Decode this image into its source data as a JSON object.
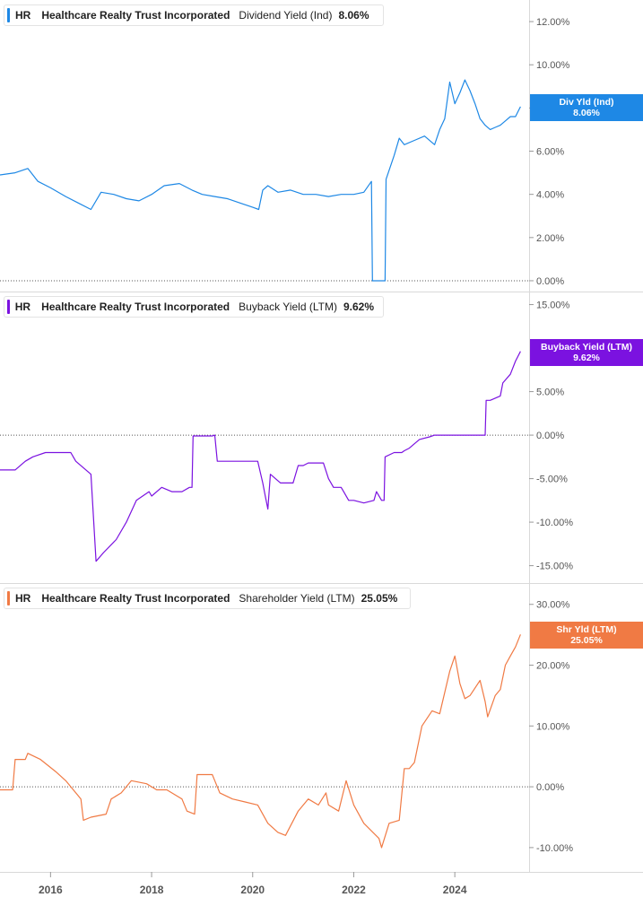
{
  "colors": {
    "dividend": "#1e88e5",
    "buyback": "#7b12e0",
    "shareholder": "#f07a44",
    "grid": "#d9d9d9",
    "axis_text": "#555555"
  },
  "x_axis": {
    "tick_labels": [
      "2016",
      "2018",
      "2020",
      "2022",
      "2024"
    ]
  },
  "chart_data": [
    {
      "type": "line",
      "ticker": "HR",
      "company": "Healthcare Realty Trust Incorporated",
      "metric": "Dividend Yield (Ind)",
      "current_value": "8.06%",
      "badge_label": "Div Yld (Ind)",
      "badge_value": "8.06%",
      "y_unit": "%",
      "ylim": [
        -0.5,
        13.0
      ],
      "yticks": [
        0,
        2,
        4,
        6,
        8,
        10,
        12
      ],
      "ytick_labels": [
        "0.00%",
        "2.00%",
        "4.00%",
        "6.00%",
        "8.00%",
        "10.00%",
        "12.00%"
      ],
      "zero_line": "dotted",
      "series": [
        {
          "x": [
            2015.0,
            2015.3,
            2015.55,
            2015.75,
            2016.0,
            2016.3,
            2016.55,
            2016.8,
            2017.0,
            2017.25,
            2017.5,
            2017.75,
            2018.0,
            2018.25,
            2018.55,
            2018.8,
            2019.0,
            2019.25,
            2019.5,
            2019.75,
            2020.0,
            2020.12,
            2020.2,
            2020.3,
            2020.5,
            2020.75,
            2021.0,
            2021.25,
            2021.5,
            2021.75,
            2022.0,
            2022.2,
            2022.35,
            2022.37,
            2022.62,
            2022.64,
            2022.8,
            2022.9,
            2023.0,
            2023.2,
            2023.4,
            2023.6,
            2023.7,
            2023.8,
            2023.9,
            2024.0,
            2024.1,
            2024.2,
            2024.3,
            2024.4,
            2024.5,
            2024.6,
            2024.7,
            2024.8,
            2024.9,
            2025.0,
            2025.1,
            2025.2,
            2025.3
          ],
          "y": [
            4.9,
            5.0,
            5.2,
            4.6,
            4.3,
            3.9,
            3.6,
            3.3,
            4.1,
            4.0,
            3.8,
            3.7,
            4.0,
            4.4,
            4.5,
            4.2,
            4.0,
            3.9,
            3.8,
            3.6,
            3.4,
            3.3,
            4.2,
            4.4,
            4.1,
            4.2,
            4.0,
            4.0,
            3.9,
            4.0,
            4.0,
            4.1,
            4.6,
            0.0,
            0.0,
            4.7,
            5.8,
            6.6,
            6.3,
            6.5,
            6.7,
            6.3,
            7.0,
            7.5,
            9.2,
            8.2,
            8.7,
            9.3,
            8.8,
            8.2,
            7.5,
            7.2,
            7.0,
            7.1,
            7.2,
            7.4,
            7.6,
            7.6,
            8.06
          ]
        }
      ]
    },
    {
      "type": "line",
      "ticker": "HR",
      "company": "Healthcare Realty Trust Incorporated",
      "metric": "Buyback Yield (LTM)",
      "current_value": "9.62%",
      "badge_label": "Buyback Yield (LTM)",
      "badge_value": "9.62%",
      "y_unit": "%",
      "ylim": [
        -17.0,
        16.5
      ],
      "yticks": [
        -15,
        -10,
        -5,
        0,
        5,
        15
      ],
      "ytick_labels": [
        "-15.00%",
        "-10.00%",
        "-5.00%",
        "0.00%",
        "5.00%",
        "15.00%"
      ],
      "zero_line": "dotted",
      "series": [
        {
          "x": [
            2015.0,
            2015.3,
            2015.5,
            2015.65,
            2015.9,
            2016.1,
            2016.4,
            2016.45,
            2016.5,
            2016.8,
            2016.9,
            2017.05,
            2017.3,
            2017.5,
            2017.7,
            2017.95,
            2018.0,
            2018.2,
            2018.4,
            2018.6,
            2018.75,
            2018.8,
            2018.82,
            2019.1,
            2019.2,
            2019.25,
            2019.3,
            2019.5,
            2019.8,
            2019.95,
            2020.1,
            2020.2,
            2020.25,
            2020.3,
            2020.35,
            2020.55,
            2020.65,
            2020.8,
            2020.9,
            2021.0,
            2021.1,
            2021.2,
            2021.4,
            2021.5,
            2021.6,
            2021.75,
            2021.8,
            2021.9,
            2022.0,
            2022.2,
            2022.4,
            2022.45,
            2022.55,
            2022.6,
            2022.62,
            2022.8,
            2022.95,
            2023.0,
            2023.1,
            2023.3,
            2023.5,
            2023.6,
            2023.7,
            2023.9,
            2024.1,
            2024.3,
            2024.5,
            2024.6,
            2024.62,
            2024.7,
            2024.9,
            2024.95,
            2025.1,
            2025.2,
            2025.3
          ],
          "y": [
            -4.0,
            -4.0,
            -3.0,
            -2.5,
            -2.0,
            -2.0,
            -2.0,
            -2.5,
            -3.0,
            -4.5,
            -14.5,
            -13.5,
            -12.0,
            -10.0,
            -7.5,
            -6.5,
            -7.0,
            -6.0,
            -6.5,
            -6.5,
            -6.0,
            -6.0,
            -0.1,
            -0.1,
            -0.1,
            0.0,
            -3.0,
            -3.0,
            -3.0,
            -3.0,
            -3.0,
            -5.5,
            -7.0,
            -8.5,
            -4.5,
            -5.5,
            -5.5,
            -5.5,
            -3.5,
            -3.5,
            -3.2,
            -3.2,
            -3.2,
            -5.0,
            -6.0,
            -6.0,
            -6.5,
            -7.5,
            -7.5,
            -7.8,
            -7.5,
            -6.5,
            -7.5,
            -7.5,
            -2.5,
            -2.0,
            -2.0,
            -1.8,
            -1.5,
            -0.5,
            -0.2,
            0.0,
            0.0,
            0.0,
            0.0,
            0.0,
            0.0,
            0.0,
            4.0,
            4.0,
            4.5,
            6.0,
            7.0,
            8.5,
            9.62
          ]
        }
      ]
    },
    {
      "type": "line",
      "ticker": "HR",
      "company": "Healthcare Realty Trust Incorporated",
      "metric": "Shareholder Yield (LTM)",
      "current_value": "25.05%",
      "badge_label": "Shr Yld (LTM)",
      "badge_value": "25.05%",
      "y_unit": "%",
      "ylim": [
        -14.0,
        33.5
      ],
      "yticks": [
        -10,
        0,
        10,
        20,
        30
      ],
      "ytick_labels": [
        "-10.00%",
        "0.00%",
        "10.00%",
        "20.00%",
        "30.00%"
      ],
      "zero_line": "dotted",
      "series": [
        {
          "x": [
            2015.0,
            2015.25,
            2015.3,
            2015.5,
            2015.55,
            2015.8,
            2016.1,
            2016.3,
            2016.6,
            2016.65,
            2016.8,
            2017.1,
            2017.2,
            2017.4,
            2017.6,
            2017.9,
            2018.1,
            2018.3,
            2018.6,
            2018.7,
            2018.85,
            2018.9,
            2019.2,
            2019.25,
            2019.35,
            2019.6,
            2019.85,
            2020.1,
            2020.2,
            2020.3,
            2020.5,
            2020.65,
            2020.9,
            2021.1,
            2021.3,
            2021.45,
            2021.5,
            2021.7,
            2021.85,
            2022.0,
            2022.2,
            2022.5,
            2022.55,
            2022.7,
            2022.9,
            2023.0,
            2023.1,
            2023.2,
            2023.35,
            2023.55,
            2023.7,
            2023.9,
            2024.0,
            2024.1,
            2024.2,
            2024.3,
            2024.5,
            2024.6,
            2024.65,
            2024.8,
            2024.9,
            2025.0,
            2025.1,
            2025.2,
            2025.3
          ],
          "y": [
            -0.5,
            -0.5,
            4.5,
            4.5,
            5.5,
            4.5,
            2.5,
            1.0,
            -2.0,
            -5.5,
            -5.0,
            -4.5,
            -2.0,
            -1.0,
            1.0,
            0.5,
            -0.5,
            -0.5,
            -2.0,
            -4.0,
            -4.5,
            2.0,
            2.0,
            1.0,
            -1.0,
            -2.0,
            -2.5,
            -3.0,
            -4.5,
            -6.0,
            -7.5,
            -8.0,
            -4.0,
            -2.0,
            -3.0,
            -1.0,
            -3.0,
            -4.0,
            1.0,
            -3.0,
            -6.0,
            -8.5,
            -10.0,
            -6.0,
            -5.5,
            3.0,
            3.0,
            4.0,
            10.0,
            12.5,
            12.0,
            19.0,
            21.5,
            17.0,
            14.5,
            15.0,
            17.5,
            14.0,
            11.5,
            15.0,
            16.0,
            20.0,
            21.5,
            23.0,
            25.05
          ]
        }
      ]
    }
  ]
}
